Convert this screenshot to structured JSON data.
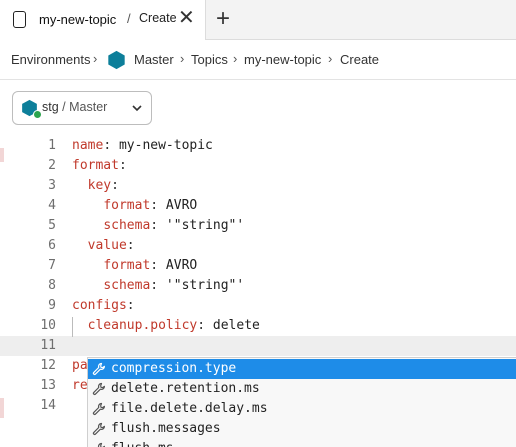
{
  "tab": {
    "title": "my-new-topic",
    "separator": "/",
    "subtitle": "Create",
    "close": "✕",
    "new_tab": "+"
  },
  "breadcrumb": {
    "environments": "Environments",
    "master": "Master",
    "topics": "Topics",
    "topic": "my-new-topic",
    "create": "Create",
    "separator": "›"
  },
  "env_selector": {
    "env": "stg",
    "separator": "/",
    "cluster": "Master",
    "status_color": "#2ca44e"
  },
  "colors": {
    "brand_hex": "#0d7f9a",
    "yaml_key": "#c0392b",
    "selection": "#1e8ce8"
  },
  "editor": {
    "lines": [
      {
        "n": "1",
        "key": "name",
        "value": " my-new-topic",
        "indent": ""
      },
      {
        "n": "2",
        "key": "format",
        "value": "",
        "indent": ""
      },
      {
        "n": "3",
        "key": "key",
        "value": "",
        "indent": "  "
      },
      {
        "n": "4",
        "key": "format",
        "value": " AVRO",
        "indent": "    "
      },
      {
        "n": "5",
        "key": "schema",
        "value": " '\"string\"'",
        "indent": "    "
      },
      {
        "n": "6",
        "key": "value",
        "value": "",
        "indent": "  "
      },
      {
        "n": "7",
        "key": "format",
        "value": " AVRO",
        "indent": "    "
      },
      {
        "n": "8",
        "key": "schema",
        "value": " '\"string\"'",
        "indent": "    "
      },
      {
        "n": "9",
        "key": "configs",
        "value": "",
        "indent": ""
      },
      {
        "n": "10",
        "key": "cleanup.policy",
        "value": " delete",
        "indent": "  "
      },
      {
        "n": "11",
        "key": "",
        "value": "",
        "indent": ""
      },
      {
        "n": "12",
        "key": "pa",
        "value": "",
        "indent": "",
        "partial": true
      },
      {
        "n": "13",
        "key": "re",
        "value": "",
        "indent": "",
        "partial": true
      },
      {
        "n": "14",
        "key": "",
        "value": "",
        "indent": ""
      }
    ]
  },
  "suggestions": [
    {
      "label": "compression.type",
      "icon": "wrench-icon",
      "selected": true
    },
    {
      "label": "delete.retention.ms",
      "icon": "wrench-icon"
    },
    {
      "label": "file.delete.delay.ms",
      "icon": "wrench-icon"
    },
    {
      "label": "flush.messages",
      "icon": "wrench-icon"
    },
    {
      "label": "flush.ms",
      "icon": "wrench-icon"
    }
  ]
}
